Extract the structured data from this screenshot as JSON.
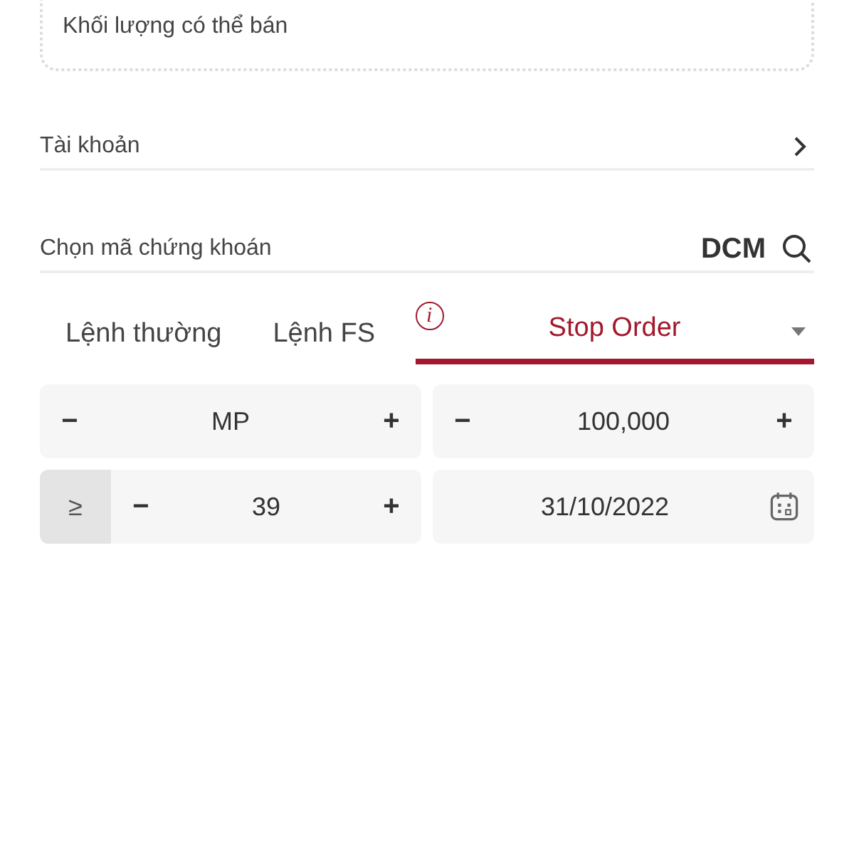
{
  "available_volume": {
    "label": "Khối lượng có thể bán"
  },
  "account": {
    "label": "Tài khoản"
  },
  "symbol": {
    "label": "Chọn mã chứng khoán",
    "value": "DCM"
  },
  "tabs": [
    {
      "label": "Lệnh thường",
      "selected": false
    },
    {
      "label": "Lệnh FS",
      "selected": false
    },
    {
      "label": "Stop Order",
      "selected": true,
      "info": "i"
    }
  ],
  "fields": [
    {
      "kind": "stepper",
      "minus": "−",
      "value": "MP",
      "plus": "+"
    },
    {
      "kind": "stepper",
      "minus": "−",
      "value": "100,000",
      "plus": "+"
    },
    {
      "kind": "stepper",
      "prefix": "≥",
      "minus": "−",
      "value": "39",
      "plus": "+"
    },
    {
      "kind": "date",
      "value": "31/10/2022"
    }
  ]
}
